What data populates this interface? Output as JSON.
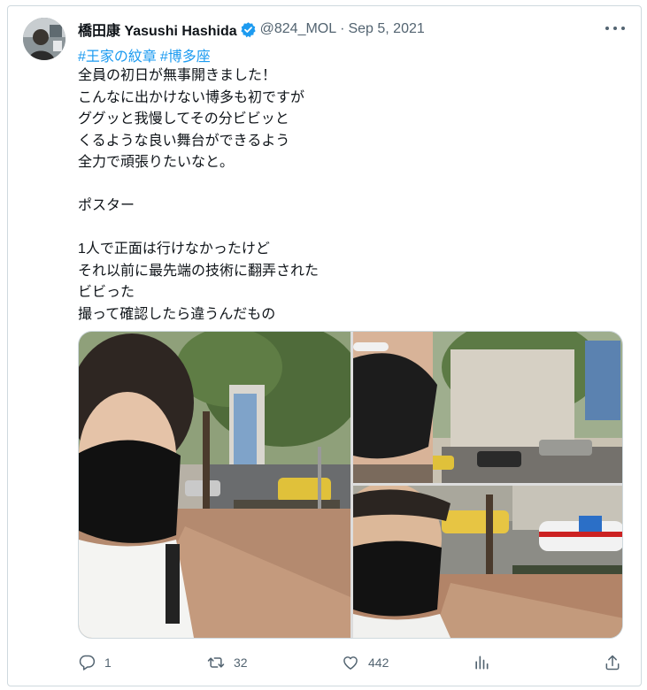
{
  "author": {
    "display_name": "橋田康 Yasushi Hashida",
    "handle": "@824_MOL",
    "separator": "·",
    "date": "Sep 5, 2021",
    "verified_icon": "verified-badge-icon",
    "verified_color": "#1d9bf0"
  },
  "more_icon": "more-horizontal-icon",
  "hashtags": [
    "#王家の紋章",
    "#博多座"
  ],
  "body_lines": [
    "全員の初日が無事開きました！",
    "こんなに出かけない博多も初ですが",
    "ググッと我慢してその分ビビッと",
    "くるような良い舞台ができるよう",
    "全力で頑張りたいなと。",
    "",
    "ポスター",
    "",
    "1人で正面は行けなかったけど",
    "それ以前に最先端の技術に翻弄された",
    "ビビった",
    "撮って確認したら違うんだもの"
  ],
  "media": {
    "photo_count": 3,
    "photos": [
      "selfie-street-photo",
      "profile-mask-photo",
      "selfie-taxi-photo"
    ]
  },
  "actions": {
    "reply": {
      "icon": "reply-icon",
      "count": "1"
    },
    "retweet": {
      "icon": "retweet-icon",
      "count": "32"
    },
    "like": {
      "icon": "heart-icon",
      "count": "442"
    },
    "views": {
      "icon": "analytics-icon"
    },
    "share": {
      "icon": "share-icon"
    }
  },
  "colors": {
    "text": "#0f1419",
    "secondary": "#536471",
    "link": "#1d9bf0",
    "border": "#cfd9de"
  }
}
